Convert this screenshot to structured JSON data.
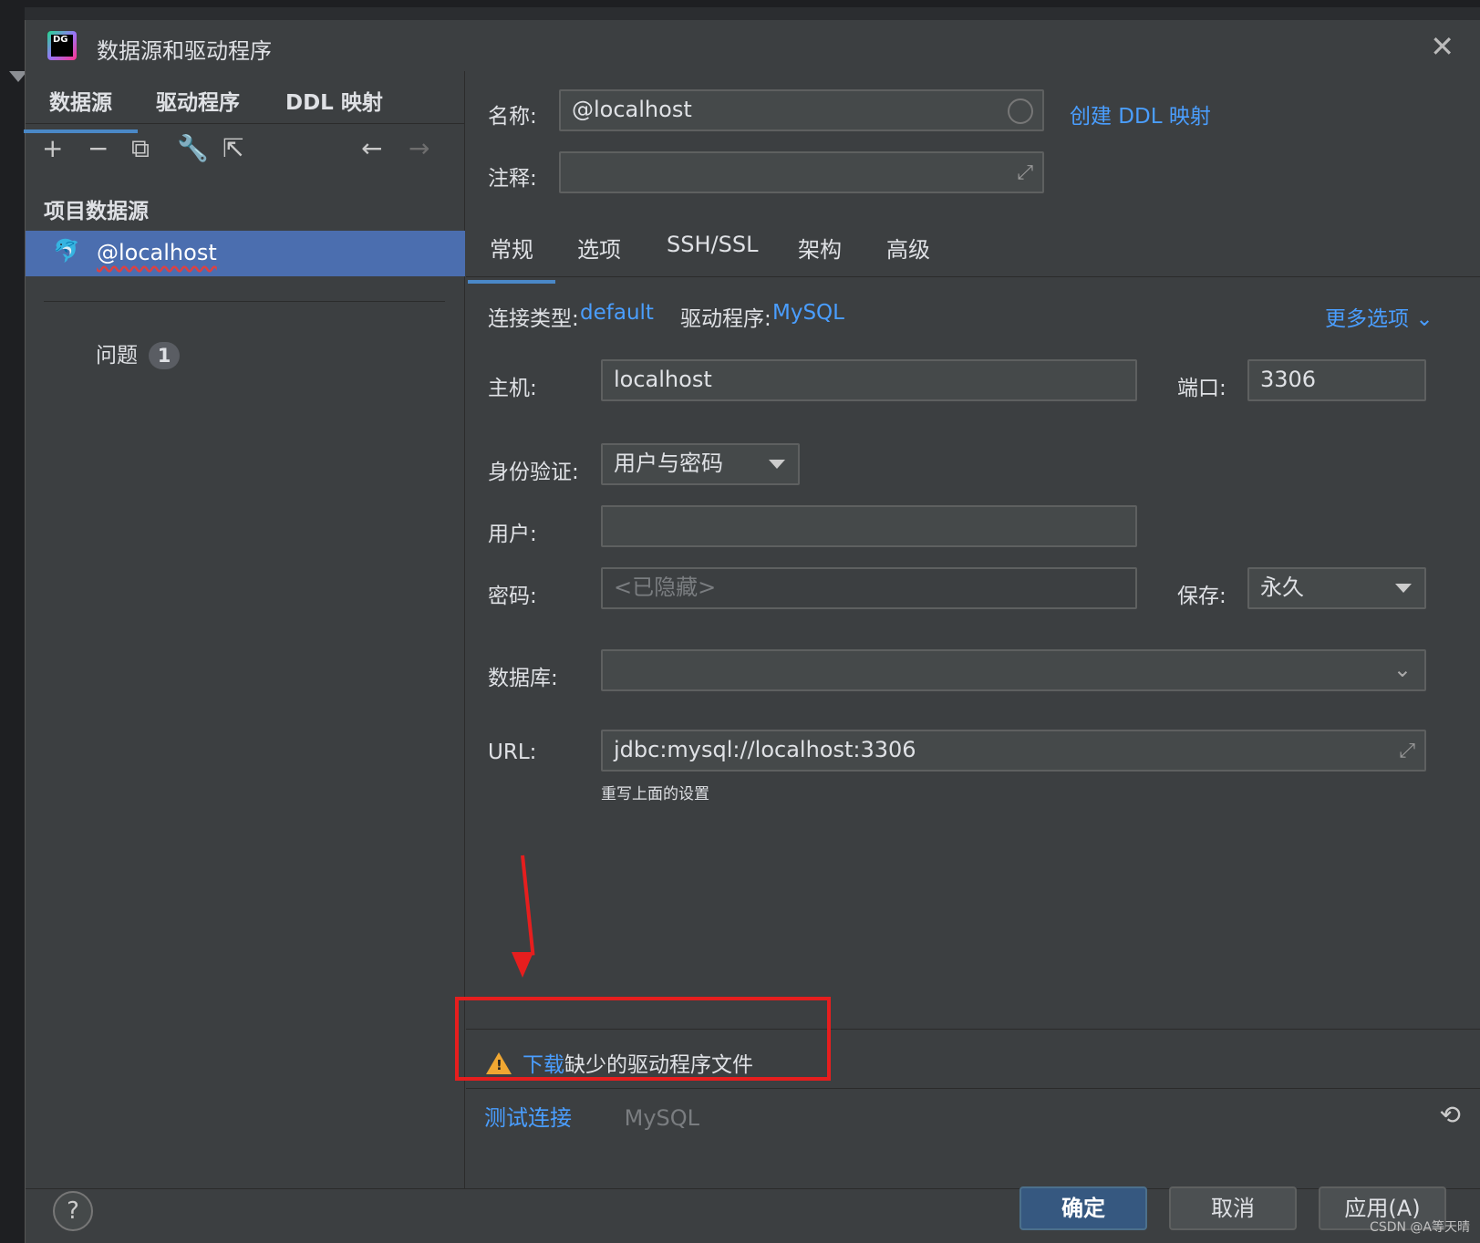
{
  "window": {
    "title": "数据源和驱动程序",
    "logo_text": "DG"
  },
  "left": {
    "tabs": [
      "数据源",
      "驱动程序",
      "DDL 映射"
    ],
    "section_title": "项目数据源",
    "selected_item": "@localhost",
    "problems_label": "问题",
    "problems_count": "1"
  },
  "header": {
    "name_label": "名称:",
    "name_value": "@localhost",
    "create_ddl_link": "创建 DDL 映射",
    "comment_label": "注释:",
    "comment_value": ""
  },
  "tabs": [
    "常规",
    "选项",
    "SSH/SSL",
    "架构",
    "高级"
  ],
  "general": {
    "conn_type_label": "连接类型:",
    "conn_type_value": "default",
    "driver_label": "驱动程序:",
    "driver_value": "MySQL",
    "more_options": "更多选项",
    "host_label": "主机:",
    "host_value": "localhost",
    "port_label": "端口:",
    "port_value": "3306",
    "auth_label": "身份验证:",
    "auth_value": "用户与密码",
    "user_label": "用户:",
    "user_value": "",
    "password_label": "密码:",
    "password_placeholder": "<已隐藏>",
    "save_label": "保存:",
    "save_value": "永久",
    "database_label": "数据库:",
    "database_value": "",
    "url_label": "URL:",
    "url_value": "jdbc:mysql://localhost:3306",
    "url_hint": "重写上面的设置"
  },
  "warning": {
    "link": "下载",
    "text": "缺少的驱动程序文件"
  },
  "testbar": {
    "test_link": "测试连接",
    "driver_name": "MySQL"
  },
  "footer": {
    "help": "?",
    "ok": "确定",
    "cancel": "取消",
    "apply": "应用(A)",
    "watermark": "CSDN @A等天晴"
  },
  "colors": {
    "accent": "#4a9eff",
    "selection": "#4b6eaf",
    "annotation": "#e61e1e",
    "warning": "#f0a732"
  }
}
